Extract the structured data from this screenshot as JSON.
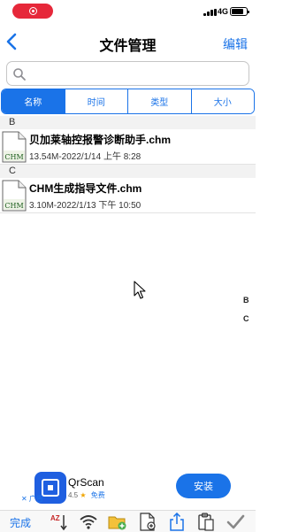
{
  "status_bar": {
    "network": "4G"
  },
  "nav": {
    "title": "文件管理",
    "edit_label": "编辑"
  },
  "search": {
    "placeholder": ""
  },
  "sort_tabs": [
    {
      "label": "名称",
      "active": true
    },
    {
      "label": "时间",
      "active": false
    },
    {
      "label": "类型",
      "active": false
    },
    {
      "label": "大小",
      "active": false
    }
  ],
  "sections": [
    {
      "letter": "B",
      "files": [
        {
          "name": "贝加莱轴控报警诊断助手.chm",
          "meta": "13.54M-2022/1/14 上午 8:28",
          "icon_label": "CHM"
        }
      ]
    },
    {
      "letter": "C",
      "files": [
        {
          "name": "CHM生成指导文件.chm",
          "meta": "3.10M-2022/1/13 下午 10:50",
          "icon_label": "CHM"
        }
      ]
    }
  ],
  "index_letters": [
    "B",
    "C"
  ],
  "ad": {
    "app_name": "QrScan",
    "rating": "4.5",
    "star": "★",
    "price": "免费",
    "install_label": "安装",
    "tag": "✕ 广告"
  },
  "toolbar": {
    "done_label": "完成",
    "sort_icon_label": "AZ",
    "icons": [
      "sort-az-icon",
      "wifi-icon",
      "folder-add-icon",
      "new-file-icon",
      "share-icon",
      "paste-icon",
      "checkmark-icon"
    ]
  },
  "colors": {
    "accent": "#1a73e8",
    "record": "#e6283a",
    "ad_logo": "#1f5fe0"
  }
}
